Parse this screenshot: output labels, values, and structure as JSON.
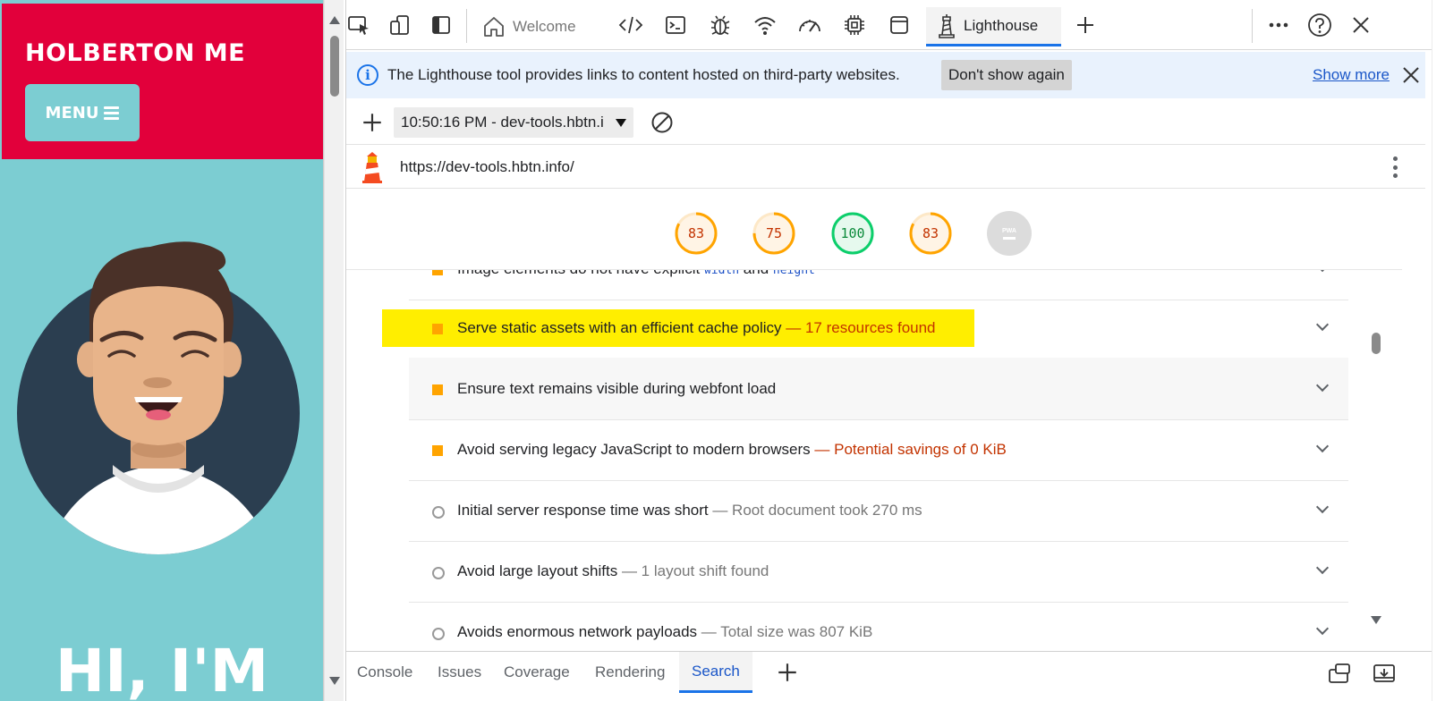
{
  "page": {
    "site_title": "HOLBERTON ME",
    "menu_label": "MENU",
    "hero_text": "HI, I'M"
  },
  "toolbar": {
    "tabs": [
      {
        "label": "Welcome",
        "icon": "home-icon"
      },
      {
        "label": "Lighthouse",
        "icon": "lighthouse-icon"
      }
    ],
    "icons": [
      "inspect-icon",
      "device-emulation-icon",
      "dock-icon",
      "elements-icon",
      "console-icon",
      "sources-bug-icon",
      "network-wifi-icon",
      "performance-gauge-icon",
      "memory-chip-icon",
      "application-window-icon",
      "add-tab-icon",
      "more-icon",
      "help-icon",
      "close-icon"
    ]
  },
  "infobar": {
    "text": "The Lighthouse tool provides links to content hosted on third-party websites.",
    "dont_show_label": "Don't show again",
    "show_more_label": "Show more"
  },
  "reportbar": {
    "selected_report": "10:50:16 PM - dev-tools.hbtn.i"
  },
  "urlbar": {
    "url": "https://dev-tools.hbtn.info/"
  },
  "scores": [
    {
      "value": "83",
      "fraction": 0.83,
      "color": "#ffa400"
    },
    {
      "value": "75",
      "fraction": 0.75,
      "color": "#ffa400"
    },
    {
      "value": "100",
      "fraction": 1.0,
      "color": "#0cce6b"
    },
    {
      "value": "83",
      "fraction": 0.83,
      "color": "#ffa400"
    }
  ],
  "pwa_label": "PWA",
  "audits": [
    {
      "title_pre": "Image elements do not have explicit ",
      "code1": "width",
      "mid": " and ",
      "code2": "height",
      "detail": "",
      "status": "warn"
    },
    {
      "title": "Serve static assets with an efficient cache policy",
      "detail": " — 17 resources found",
      "status": "warn"
    },
    {
      "title": "Ensure text remains visible during webfont load",
      "detail": "",
      "status": "warn"
    },
    {
      "title": "Avoid serving legacy JavaScript to modern browsers",
      "detail": " — Potential savings of 0 KiB",
      "status": "warn"
    },
    {
      "title": "Initial server response time was short",
      "detail": " — Root document took 270 ms",
      "status": "pass"
    },
    {
      "title": "Avoid large layout shifts",
      "detail": " — 1 layout shift found",
      "status": "pass"
    },
    {
      "title": "Avoids enormous network payloads",
      "detail": " — Total size was 807 KiB",
      "status": "pass"
    }
  ],
  "drawer": {
    "tabs": [
      "Console",
      "Issues",
      "Coverage",
      "Rendering",
      "Search"
    ],
    "active": "Search"
  },
  "colors": {
    "brand_red": "#e2003b",
    "brand_teal": "#7ccdd2",
    "accent_blue": "#1a73e8",
    "warn_orange": "#ffa400",
    "highlight_yellow": "#ffee00"
  }
}
